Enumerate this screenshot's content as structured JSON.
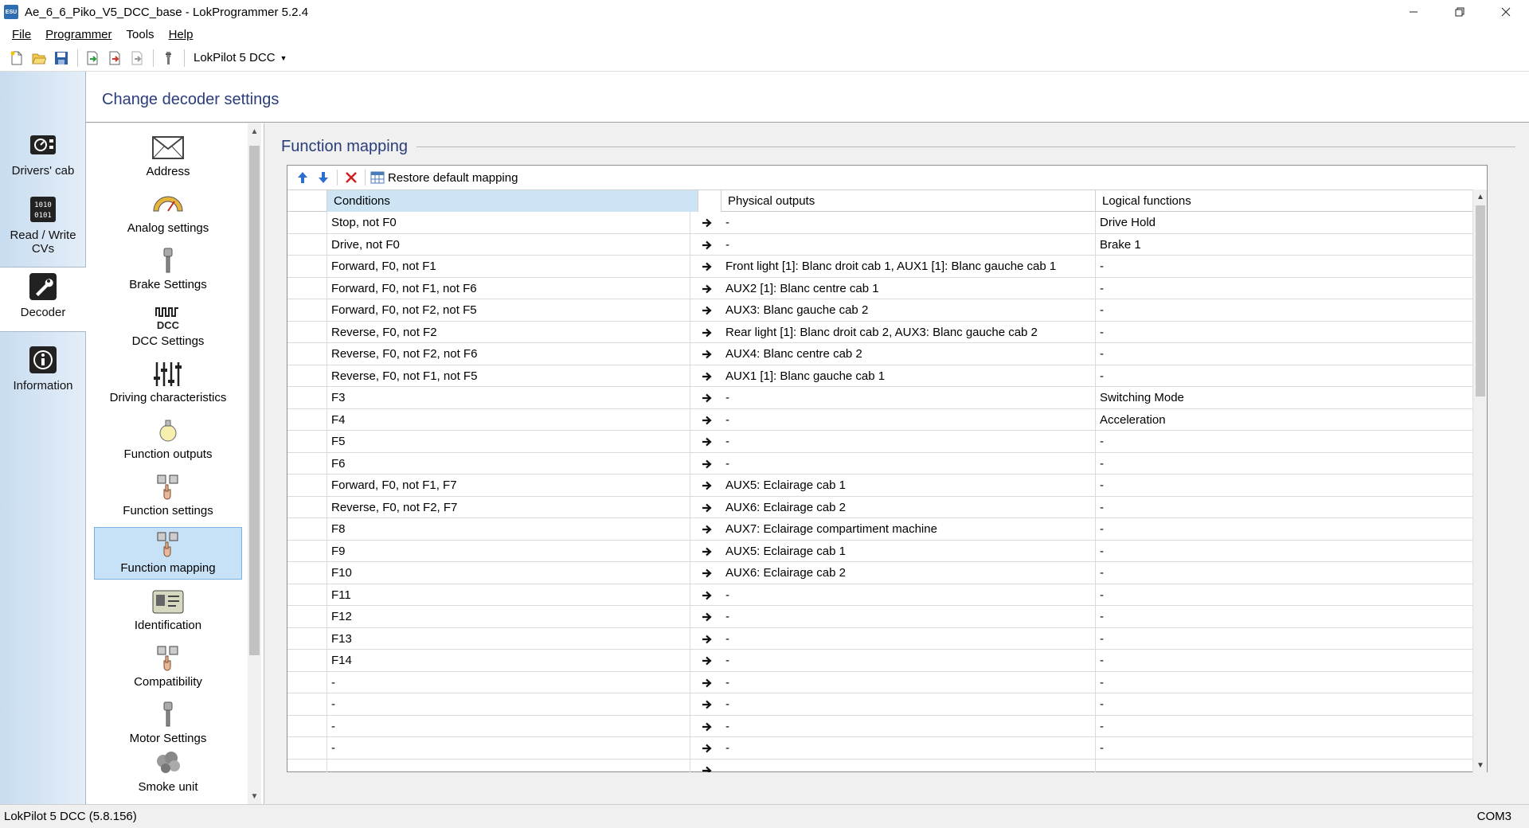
{
  "window": {
    "title": "Ae_6_6_Piko_V5_DCC_base - LokProgrammer 5.2.4",
    "app_icon": "ESU",
    "controls": [
      "minimize-icon",
      "restore-icon",
      "close-icon"
    ]
  },
  "menu": {
    "file": "File",
    "programmer": "Programmer",
    "tools": "Tools",
    "help": "Help"
  },
  "toolbar": {
    "decoder_select": "LokPilot 5 DCC"
  },
  "leftnav": {
    "items": [
      {
        "label": "Drivers' cab",
        "icon": "drivers-cab-icon"
      },
      {
        "label": "Read / Write CVs",
        "icon": "read-write-cvs-icon"
      },
      {
        "label": "Decoder",
        "icon": "decoder-wrench-icon"
      },
      {
        "label": "Information",
        "icon": "information-icon"
      }
    ],
    "active": "Decoder"
  },
  "header": {
    "title": "Change decoder settings"
  },
  "categories": {
    "items": [
      {
        "label": "Address",
        "icon": "envelope-icon"
      },
      {
        "label": "Analog settings",
        "icon": "gauge-icon"
      },
      {
        "label": "Brake Settings",
        "icon": "brake-icon"
      },
      {
        "label": "DCC Settings",
        "icon": "dcc-icon"
      },
      {
        "label": "Driving characteristics",
        "icon": "sliders-icon"
      },
      {
        "label": "Function outputs",
        "icon": "lightbulb-icon"
      },
      {
        "label": "Function settings",
        "icon": "function-buttons-icon"
      },
      {
        "label": "Function mapping",
        "icon": "function-mapping-icon"
      },
      {
        "label": "Identification",
        "icon": "id-card-icon"
      },
      {
        "label": "Compatibility",
        "icon": "compatibility-icon"
      },
      {
        "label": "Motor Settings",
        "icon": "motor-icon"
      },
      {
        "label": "Smoke unit",
        "icon": "smoke-icon"
      }
    ],
    "selected": "Function mapping"
  },
  "section": {
    "title": "Function mapping",
    "restore_label": "Restore default mapping"
  },
  "grid": {
    "columns": {
      "conditions": "Conditions",
      "physical": "Physical outputs",
      "logical": "Logical functions"
    },
    "rows": [
      {
        "cond": "Stop, not F0",
        "phys": "-",
        "log": "Drive Hold"
      },
      {
        "cond": "Drive, not F0",
        "phys": "-",
        "log": "Brake 1"
      },
      {
        "cond": "Forward, F0, not F1",
        "phys": "Front light [1]: Blanc droit cab 1, AUX1 [1]: Blanc gauche cab 1",
        "log": "-"
      },
      {
        "cond": "Forward, F0, not F1, not F6",
        "phys": "AUX2 [1]: Blanc centre cab 1",
        "log": "-"
      },
      {
        "cond": "Forward, F0, not F2, not F5",
        "phys": "AUX3: Blanc gauche cab 2",
        "log": "-"
      },
      {
        "cond": "Reverse, F0, not F2",
        "phys": "Rear light [1]: Blanc droit cab 2, AUX3: Blanc gauche cab 2",
        "log": "-"
      },
      {
        "cond": "Reverse, F0, not F2, not F6",
        "phys": "AUX4: Blanc centre cab 2",
        "log": "-"
      },
      {
        "cond": "Reverse, F0, not F1, not F5",
        "phys": "AUX1 [1]: Blanc gauche cab 1",
        "log": "-"
      },
      {
        "cond": "F3",
        "phys": "-",
        "log": "Switching Mode"
      },
      {
        "cond": "F4",
        "phys": "-",
        "log": "Acceleration"
      },
      {
        "cond": "F5",
        "phys": "-",
        "log": "-"
      },
      {
        "cond": "F6",
        "phys": "-",
        "log": "-"
      },
      {
        "cond": "Forward, F0, not F1, F7",
        "phys": "AUX5: Eclairage cab 1",
        "log": "-"
      },
      {
        "cond": "Reverse, F0, not F2, F7",
        "phys": "AUX6: Eclairage cab 2",
        "log": "-"
      },
      {
        "cond": "F8",
        "phys": "AUX7: Eclairage compartiment machine",
        "log": "-"
      },
      {
        "cond": "F9",
        "phys": "AUX5: Eclairage cab 1",
        "log": "-"
      },
      {
        "cond": "F10",
        "phys": "AUX6: Eclairage cab 2",
        "log": "-"
      },
      {
        "cond": "F11",
        "phys": "-",
        "log": "-"
      },
      {
        "cond": "F12",
        "phys": "-",
        "log": "-"
      },
      {
        "cond": "F13",
        "phys": "-",
        "log": "-"
      },
      {
        "cond": "F14",
        "phys": "-",
        "log": "-"
      },
      {
        "cond": "-",
        "phys": "-",
        "log": "-"
      },
      {
        "cond": "-",
        "phys": "-",
        "log": "-"
      },
      {
        "cond": "-",
        "phys": "-",
        "log": "-"
      },
      {
        "cond": "-",
        "phys": "-",
        "log": "-"
      },
      {
        "cond": "",
        "phys": "",
        "log": ""
      }
    ]
  },
  "status": {
    "decoder": "LokPilot 5 DCC (5.8.156)",
    "port": "COM3"
  },
  "colors": {
    "accent_title": "#2a3d7a",
    "selection": "#c7e2f7",
    "header_highlight": "#cde4f5"
  }
}
